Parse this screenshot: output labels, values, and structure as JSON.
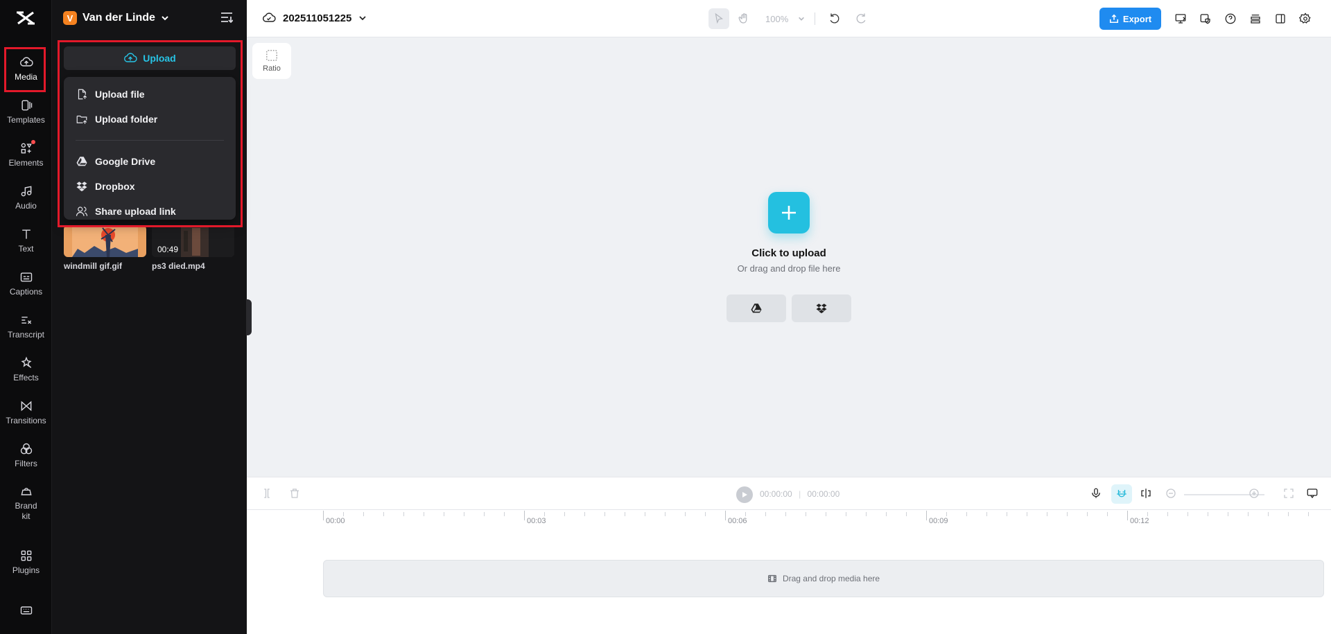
{
  "rail": {
    "items": [
      {
        "label": "Media",
        "icon": "cloud-upload-icon"
      },
      {
        "label": "Templates",
        "icon": "templates-icon"
      },
      {
        "label": "Elements",
        "icon": "elements-icon"
      },
      {
        "label": "Audio",
        "icon": "music-note-icon"
      },
      {
        "label": "Text",
        "icon": "text-icon"
      },
      {
        "label": "Captions",
        "icon": "captions-icon"
      },
      {
        "label": "Transcript",
        "icon": "transcript-icon"
      },
      {
        "label": "Effects",
        "icon": "effects-icon"
      },
      {
        "label": "Transitions",
        "icon": "transitions-icon"
      },
      {
        "label": "Filters",
        "icon": "filters-icon"
      },
      {
        "label": "Brand kit",
        "icon": "brand-kit-icon"
      },
      {
        "label": "Plugins",
        "icon": "plugins-icon"
      }
    ]
  },
  "panel": {
    "workspace_initial": "V",
    "workspace_name": "Van der Linde",
    "upload_label": "Upload",
    "dropdown": {
      "upload_file": "Upload file",
      "upload_folder": "Upload folder",
      "google_drive": "Google Drive",
      "dropbox": "Dropbox",
      "share_link": "Share upload link"
    },
    "media": [
      {
        "name": "windmill gif.gif"
      },
      {
        "name": "ps3 died.mp4",
        "duration": "00:49"
      }
    ]
  },
  "topbar": {
    "project_name": "202511051225",
    "zoom": "100%",
    "export_label": "Export"
  },
  "canvas": {
    "ratio_label": "Ratio",
    "click_to_upload": "Click to upload",
    "drag_hint": "Or drag and drop file here"
  },
  "timeline": {
    "current_time": "00:00:00",
    "total_time": "00:00:00",
    "ruler": [
      "00:00",
      "00:03",
      "00:06",
      "00:09",
      "00:12"
    ],
    "drop_hint": "Drag and drop media here"
  },
  "colors": {
    "accent": "#24c0e0",
    "export": "#1f8bf0",
    "highlight": "#e3192a"
  }
}
